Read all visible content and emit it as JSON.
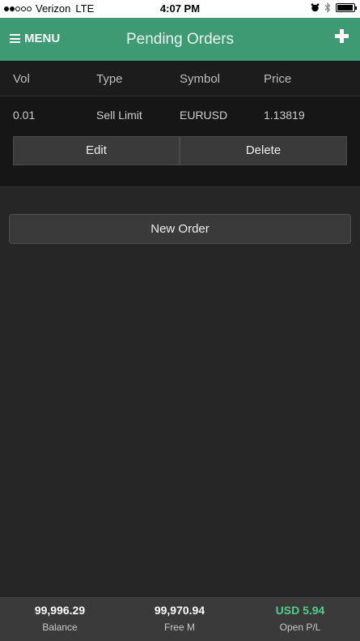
{
  "status_bar": {
    "signal_filled": 2,
    "signal_empty": 3,
    "carrier": "Verizon",
    "network": "LTE",
    "time": "4:07 PM"
  },
  "header": {
    "menu_label": "MENU",
    "title": "Pending Orders",
    "accent_color": "#3e9a72"
  },
  "table": {
    "columns": [
      "Vol",
      "Type",
      "Symbol",
      "Price"
    ],
    "orders": [
      {
        "vol": "0.01",
        "type": "Sell Limit",
        "symbol": "EURUSD",
        "price": "1.13819"
      }
    ],
    "edit_label": "Edit",
    "delete_label": "Delete"
  },
  "new_order_label": "New Order",
  "footer": {
    "balance_value": "99,996.29",
    "balance_label": "Balance",
    "free_margin_value": "99,970.94",
    "free_margin_label": "Free M",
    "open_pl_value": "USD 5.94",
    "open_pl_label": "Open P/L",
    "positive_color": "#4fd08c"
  },
  "icons": [
    "hamburger-icon",
    "add-icon",
    "alarm-icon",
    "bluetooth-icon",
    "battery-icon"
  ]
}
